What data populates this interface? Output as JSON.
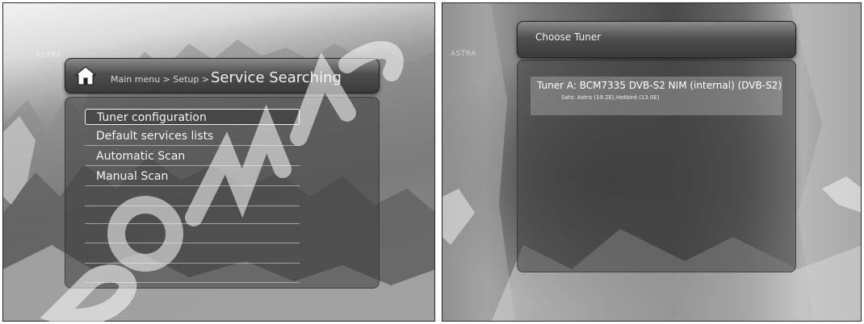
{
  "left_screen": {
    "logo": "ASTRA",
    "header": {
      "breadcrumb": "Main menu > Setup >",
      "title": "Service Searching",
      "home_icon": "home-icon"
    },
    "menu": {
      "items": [
        {
          "label": "Tuner configuration",
          "selected": true
        },
        {
          "label": "Default services lists",
          "selected": false
        },
        {
          "label": "Automatic Scan",
          "selected": false
        },
        {
          "label": "Manual Scan",
          "selected": false
        }
      ]
    }
  },
  "right_screen": {
    "logo": "ASTRA",
    "dialog": {
      "title": "Choose Tuner",
      "tuners": [
        {
          "name": "Tuner A: BCM7335 DVB-S2 NIM (internal) (DVB-S2)",
          "sats": "Sats: Astra (19.2E),Hotbird (13.0E)"
        }
      ]
    }
  },
  "watermark_text": "DOWNLOAD",
  "colors": {
    "panel": "#3c3c3c",
    "text": "#f0f0f0",
    "highlight_border": "#f0f0f0"
  }
}
